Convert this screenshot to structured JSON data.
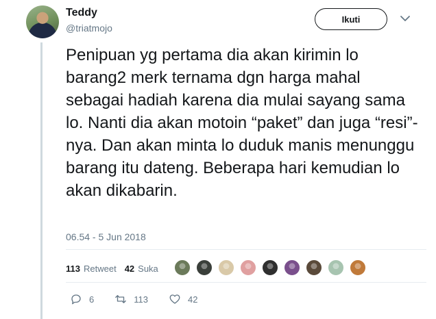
{
  "user": {
    "display_name": "Teddy",
    "handle": "@triatmojo"
  },
  "follow_button": {
    "label": "Ikuti"
  },
  "tweet": {
    "text": "Penipuan yg pertama dia akan kirimin lo barang2 merk ternama dgn harga mahal sebagai hadiah karena dia mulai sayang sama lo. Nanti dia akan motoin “paket” dan juga “resi”-nya. Dan akan minta lo duduk manis menunggu barang itu dateng. Beberapa hari kemudian lo akan dikabarin.",
    "timestamp": "06.54 - 5 Jun 2018"
  },
  "stats": {
    "retweet_count": "113",
    "retweet_label": "Retweet",
    "like_count": "42",
    "like_label": "Suka"
  },
  "liker_avatar_colors": [
    "#6b7a5a",
    "#3a3f3a",
    "#d9c9a8",
    "#e0a0a0",
    "#2f2f2f",
    "#7a4f8c",
    "#5a4a3a",
    "#a7c4b0",
    "#c07a3a"
  ],
  "actions": {
    "reply_count": "6",
    "retweet_count": "113",
    "like_count": "42"
  },
  "icons": [
    "chevron-down-icon",
    "reply-icon",
    "retweet-icon",
    "heart-icon"
  ]
}
